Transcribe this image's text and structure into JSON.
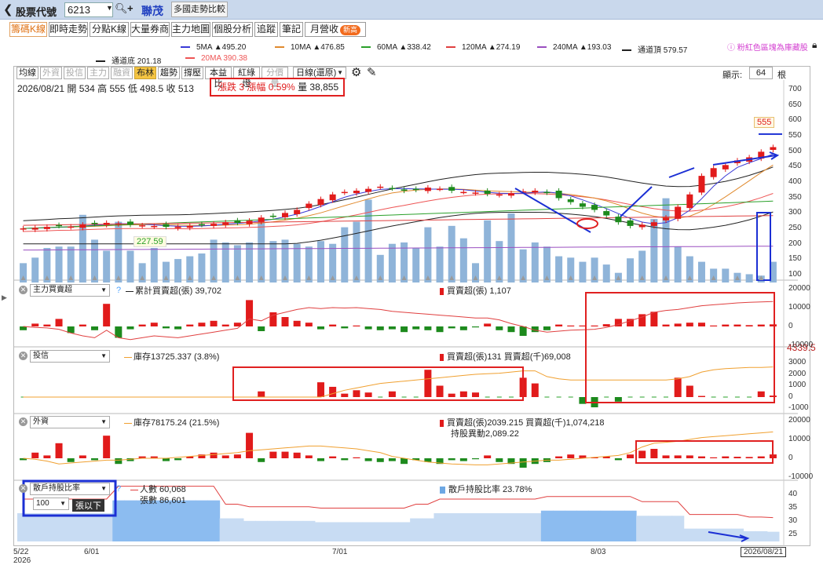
{
  "topbar": {
    "back_glyph": "❮",
    "label": "股票代號",
    "code": "6213",
    "stock_name": "聯茂",
    "compare_button": "多國走勢比較"
  },
  "tabs": [
    {
      "label": "籌碼K線",
      "active": true
    },
    {
      "label": "即時走勢"
    },
    {
      "label": "分點K線"
    },
    {
      "label": "大量券商"
    },
    {
      "label": "主力地圖"
    },
    {
      "label": "個股分析"
    },
    {
      "label": "追蹤"
    },
    {
      "label": "筆記"
    },
    {
      "label": "月營收",
      "badge": "新高"
    }
  ],
  "note": "ⓘ 粉紅色區塊為庫藏股",
  "ma_legend": [
    {
      "label": "5MA ▲495.20",
      "color": "#3a3ad6"
    },
    {
      "label": "10MA ▲476.85",
      "color": "#e08a2e"
    },
    {
      "label": "60MA ▲338.42",
      "color": "#2aa02a"
    },
    {
      "label": "120MA ▲274.19",
      "color": "#e04040"
    },
    {
      "label": "240MA ▲193.03",
      "color": "#9a4fc0"
    },
    {
      "label": "通道頂 579.57",
      "color": "#222222"
    },
    {
      "label": "通道底 201.18",
      "color": "#222222"
    },
    {
      "label": "20MA 390.38",
      "color": "#ee5555"
    }
  ],
  "ktoolbar": {
    "buttons": [
      {
        "label": "均線"
      },
      {
        "label": "外資",
        "dim": true
      },
      {
        "label": "投信",
        "dim": true
      },
      {
        "label": "主力",
        "dim": true
      },
      {
        "label": "融資",
        "dim": true
      },
      {
        "label": "布林",
        "active": true
      },
      {
        "label": "趨勢"
      },
      {
        "label": "撐壓"
      },
      {
        "label": "本益比"
      },
      {
        "label": "紅綠燈"
      },
      {
        "label": "分價量",
        "dim": true
      }
    ],
    "period": "日線(還原)",
    "display_label": "顯示:",
    "display_value": "64",
    "display_unit": "根"
  },
  "ohlc": {
    "date": "2026/08/21",
    "open": "開 534",
    "high": "高 555",
    "low": "低 498.5",
    "close": "收 513",
    "change": "漲跌 3",
    "pct": "漲幅 0.59%",
    "volume": "量 38,855"
  },
  "price_axis": [
    "700",
    "650",
    "600",
    "550",
    "500",
    "450",
    "400",
    "350",
    "300",
    "250",
    "200",
    "150",
    "100"
  ],
  "price_marker": "555",
  "low_label": "227.59",
  "panels": {
    "main_force": {
      "select": "主力買賣超",
      "q": "?",
      "cum": "累計買賣超(張) 39,702",
      "net": "買賣超(張) 1,107",
      "axis": [
        "20000",
        "10000",
        "0",
        "-10000"
      ],
      "side_value": "4339.5"
    },
    "trust": {
      "select": "投信",
      "stock": "庫存13725.337 (3.8%)",
      "net": "買賣超(張)131 買賣超(千)69,008",
      "axis": [
        "3000",
        "2000",
        "1000",
        "0",
        "-1000"
      ]
    },
    "foreign": {
      "select": "外資",
      "stock": "庫存78175.24 (21.5%)",
      "net": "買賣超(張)2039.215 買賣超(千)1,074,218",
      "change": "持股異動2,089.22",
      "axis": [
        "20000",
        "10000",
        "0",
        "-10000"
      ]
    },
    "retail": {
      "select": "散戶持股比率",
      "lots_select": "100",
      "lots_unit": "張以下",
      "people": "人數 60,068",
      "shares": "張數 86,601",
      "ratio": "散戶持股比率 23.78%",
      "axis": [
        "40",
        "35",
        "30",
        "25"
      ]
    }
  },
  "x_axis": [
    {
      "label": "5/22\n2026"
    },
    {
      "label": "6/01"
    },
    {
      "label": "7/01"
    },
    {
      "label": "8/03"
    },
    {
      "label": "2026/08/21"
    }
  ],
  "colors": {
    "up": "#e11b1b",
    "down": "#1d8a1d",
    "volume": "#8fb4d9",
    "annotate_red": "#e02020",
    "annotate_blue": "#1b2fd4"
  },
  "chart_data": [
    {
      "type": "candlestick",
      "title": "",
      "series_name": "K線",
      "ohlc_count": 64,
      "close": [
        250,
        252,
        255,
        258,
        256,
        262,
        265,
        268,
        266,
        262,
        260,
        258,
        255,
        256,
        258,
        262,
        265,
        270,
        268,
        275,
        285,
        290,
        300,
        310,
        330,
        345,
        360,
        368,
        372,
        378,
        385,
        380,
        372,
        375,
        382,
        378,
        372,
        368,
        366,
        362,
        360,
        364,
        370,
        372,
        366,
        348,
        335,
        320,
        310,
        292,
        270,
        258,
        262,
        270,
        285,
        320,
        360,
        420,
        445,
        455,
        470,
        480,
        498,
        513
      ],
      "ylim": [
        75,
        730
      ]
    },
    {
      "type": "bar",
      "series_name": "量",
      "values": [
        28,
        36,
        50,
        52,
        52,
        98,
        62,
        46,
        88,
        46,
        28,
        50,
        30,
        34,
        38,
        42,
        62,
        58,
        54,
        58,
        88,
        60,
        62,
        56,
        52,
        60,
        56,
        80,
        88,
        120,
        40,
        56,
        58,
        50,
        80,
        52,
        82,
        64,
        28,
        90,
        60,
        100,
        48,
        58,
        52,
        38,
        36,
        30,
        36,
        26,
        14,
        35,
        46,
        92,
        122,
        52,
        38,
        30,
        20,
        20,
        14,
        12,
        10,
        30
      ]
    },
    {
      "type": "bar",
      "series_name": "主力買賣超(張)",
      "values": [
        -2000,
        1500,
        1000,
        4000,
        -3500,
        1000,
        -2000,
        12000,
        -6000,
        -1500,
        1000,
        2000,
        -1000,
        -1500,
        1000,
        2000,
        3000,
        1000,
        2000,
        14000,
        -2500,
        7500,
        5000,
        3000,
        2000,
        -1500,
        1000,
        -1000,
        500,
        -1500,
        -2000,
        -1500,
        -3000,
        -1500,
        -2000,
        -3000,
        -1000,
        -2000,
        -500,
        1500,
        -2000,
        -3000,
        -5000,
        -3000,
        -2000,
        1000,
        500,
        500,
        500,
        1200,
        4000,
        4000,
        6500,
        7800,
        1000,
        1500,
        2000,
        2000,
        500,
        1000,
        1000,
        700,
        1000,
        1107
      ],
      "cumulative": [
        0,
        -500,
        -800,
        -1500,
        -3500,
        -5000,
        -6000,
        -2000,
        -6000,
        -7000,
        -6000,
        -5000,
        -5500,
        -6000,
        -5000,
        -4000,
        -3000,
        -2000,
        -1000,
        4000,
        3000,
        6000,
        7500,
        9000,
        10000,
        9500,
        10000,
        9800,
        10000,
        9500,
        9000,
        8000,
        7500,
        7000,
        6500,
        6000,
        5500,
        5000,
        4500,
        4500,
        3500,
        1500,
        0,
        -2000,
        -3000,
        -2500,
        -2000,
        -1800,
        -1500,
        -500,
        1000,
        3000,
        5000,
        7500,
        8500,
        9000,
        10000,
        11000,
        11500,
        12000,
        12500,
        12800,
        13000,
        13200
      ]
    },
    {
      "type": "bar",
      "series_name": "投信買賣超(張)",
      "values": [
        0,
        0,
        0,
        0,
        0,
        0,
        0,
        0,
        0,
        0,
        0,
        0,
        0,
        0,
        0,
        0,
        0,
        0,
        0,
        0,
        500,
        0,
        0,
        0,
        0,
        1300,
        900,
        300,
        600,
        400,
        0,
        500,
        0,
        0,
        2400,
        1000,
        300,
        500,
        400,
        0,
        0,
        0,
        1700,
        1200,
        0,
        0,
        0,
        -600,
        -900,
        0,
        -400,
        0,
        0,
        0,
        0,
        1700,
        1000,
        100,
        0,
        0,
        0,
        0,
        500,
        131
      ],
      "stock_line": [
        0,
        0,
        0,
        0,
        0,
        0,
        0,
        0,
        0,
        0,
        0,
        0,
        0,
        0,
        0,
        0,
        0,
        0,
        0,
        0,
        0,
        0,
        0,
        0,
        0,
        0,
        300,
        600,
        800,
        1000,
        1200,
        1300,
        1400,
        1500,
        1600,
        1700,
        1800,
        1900,
        2000,
        2050,
        2100,
        2200,
        2300,
        2300,
        1800,
        1600,
        1500,
        1500,
        1500,
        1500,
        1500,
        1500,
        1500,
        1500,
        1500,
        1600,
        1800,
        2200,
        2400,
        2500,
        2550,
        2600,
        2600,
        2650
      ]
    },
    {
      "type": "bar",
      "series_name": "外資買賣超(張)",
      "values": [
        -1000,
        3000,
        1500,
        8000,
        -2000,
        1500,
        -1000,
        12000,
        -3000,
        -1500,
        1000,
        1000,
        -1500,
        -1000,
        1000,
        2000,
        3000,
        1500,
        2000,
        13500,
        -2000,
        3500,
        3500,
        3000,
        1500,
        -1500,
        1000,
        -1000,
        500,
        -1500,
        -2000,
        -1500,
        -3000,
        -1000,
        -2000,
        -3000,
        -1000,
        -1500,
        -500,
        1500,
        -2000,
        -3000,
        -5000,
        -3000,
        -2000,
        1000,
        2000,
        1500,
        500,
        1000,
        -1000,
        2000,
        4000,
        5000,
        1500,
        1500,
        1500,
        1000,
        500,
        1000,
        800,
        700,
        1000,
        2039
      ],
      "stock_line": [
        0,
        -500,
        -1500,
        -3000,
        -2500,
        -2000,
        -1500,
        -1000,
        -1000,
        -500,
        0,
        0,
        0,
        500,
        1000,
        1500,
        2000,
        2500,
        3000,
        4000,
        4500,
        5000,
        5500,
        6000,
        6500,
        6500,
        6000,
        5500,
        5000,
        4000,
        3000,
        1000,
        0,
        -1000,
        -2000,
        -2500,
        -3000,
        -3200,
        -3500,
        -3500,
        -3000,
        -2500,
        -2000,
        -1500,
        -1000,
        -1000,
        -500,
        0,
        500,
        1000,
        1500,
        3000,
        6000,
        8000,
        8500,
        9000,
        10000,
        11000,
        11500,
        12000,
        12500,
        13000,
        13500,
        14000
      ]
    },
    {
      "type": "area",
      "series_name": "散戶持股比率",
      "ylim": [
        20,
        42
      ],
      "values": [
        31,
        31,
        31,
        31,
        31,
        31,
        31,
        31,
        36,
        36,
        36,
        36,
        36,
        36,
        36,
        36,
        36,
        29,
        29,
        28,
        28,
        28,
        28,
        28,
        28,
        27.5,
        27.5,
        27.5,
        27.5,
        27.5,
        27.5,
        27.5,
        27.5,
        29,
        29,
        31,
        31,
        31,
        31,
        31,
        31,
        31,
        31,
        31,
        32,
        32,
        32,
        32,
        32,
        32,
        32,
        32,
        30,
        30,
        30,
        30,
        25,
        25,
        25,
        25,
        25,
        24,
        24,
        23.78
      ]
    }
  ]
}
